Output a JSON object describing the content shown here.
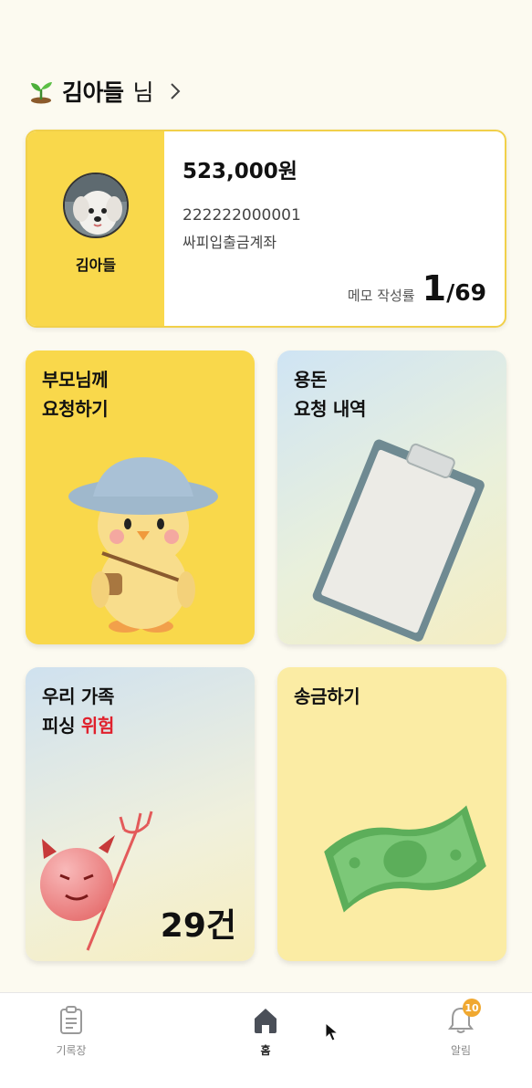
{
  "header": {
    "user_name": "김아들",
    "suffix": "님"
  },
  "account": {
    "child_name": "김아들",
    "balance": "523,000원",
    "account_number": "222222000001",
    "account_name": "싸피입출금계좌",
    "memo_label": "메모 작성률",
    "memo_done": "1",
    "memo_total": "/69"
  },
  "tiles": {
    "request": {
      "title": "부모님께\n요청하기"
    },
    "history": {
      "title": "용돈\n요청 내역"
    },
    "phishing": {
      "title_prefix": "우리 가족\n피싱 ",
      "title_danger": "위험",
      "count": "29건"
    },
    "transfer": {
      "title": "송금하기"
    }
  },
  "nav": {
    "items": [
      {
        "label": "기록장",
        "icon": "notebook-icon"
      },
      {
        "label": "홈",
        "icon": "home-icon"
      },
      {
        "label": "알림",
        "icon": "bell-icon",
        "badge": "10"
      }
    ]
  },
  "colors": {
    "accent": "#f9d84b",
    "danger": "#e0202c",
    "badge": "#f0a830"
  }
}
